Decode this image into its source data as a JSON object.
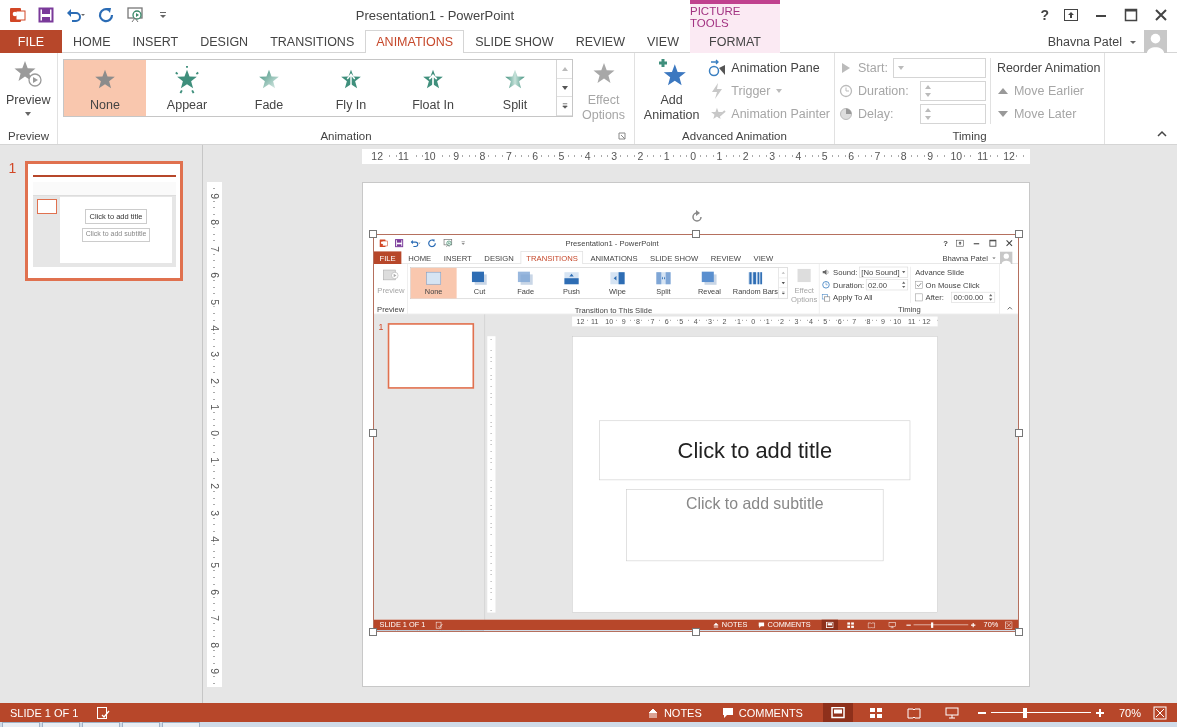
{
  "window": {
    "title": "Presentation1 - PowerPoint",
    "help": "?"
  },
  "contextual_tabs": {
    "group": "PICTURE TOOLS"
  },
  "tabs": [
    {
      "label": "FILE",
      "kind": "file",
      "selected": false
    },
    {
      "label": "HOME",
      "kind": "normal",
      "selected": false
    },
    {
      "label": "INSERT",
      "kind": "normal",
      "selected": false
    },
    {
      "label": "DESIGN",
      "kind": "normal",
      "selected": false
    },
    {
      "label": "TRANSITIONS",
      "kind": "normal",
      "selected": false
    },
    {
      "label": "ANIMATIONS",
      "kind": "normal",
      "selected": true
    },
    {
      "label": "SLIDE SHOW",
      "kind": "normal",
      "selected": false
    },
    {
      "label": "REVIEW",
      "kind": "normal",
      "selected": false
    },
    {
      "label": "VIEW",
      "kind": "normal",
      "selected": false
    },
    {
      "label": "FORMAT",
      "kind": "contextual",
      "selected": false
    }
  ],
  "user": {
    "name": "Bhavna Patel"
  },
  "ribbon": {
    "preview": {
      "label": "Preview",
      "group": "Preview"
    },
    "gallery": [
      {
        "label": "None",
        "kind": "none",
        "selected": true
      },
      {
        "label": "Appear",
        "kind": "appear",
        "selected": false
      },
      {
        "label": "Fade",
        "kind": "fade",
        "selected": false
      },
      {
        "label": "Fly In",
        "kind": "fly",
        "selected": false
      },
      {
        "label": "Float In",
        "kind": "float",
        "selected": false
      },
      {
        "label": "Split",
        "kind": "split",
        "selected": false
      }
    ],
    "effect_options": {
      "label": "Effect Options",
      "disabled": true
    },
    "animation_group": "Animation",
    "add_animation": {
      "label": "Add Animation"
    },
    "advanced": [
      {
        "label": "Animation Pane",
        "kind": "pane",
        "disabled": false
      },
      {
        "label": "Trigger",
        "kind": "trigger",
        "disabled": true
      },
      {
        "label": "Animation Painter",
        "kind": "painter",
        "disabled": true
      }
    ],
    "advanced_group": "Advanced Animation",
    "timing": [
      {
        "label": "Start:",
        "kind": "dropdown",
        "disabled": true
      },
      {
        "label": "Duration:",
        "kind": "spinner",
        "disabled": true
      },
      {
        "label": "Delay:",
        "kind": "spinner",
        "disabled": true
      }
    ],
    "reorder": {
      "title": "Reorder Animation",
      "items": [
        {
          "label": "Move Earlier",
          "kind": "up",
          "disabled": true
        },
        {
          "label": "Move Later",
          "kind": "down",
          "disabled": true
        }
      ]
    },
    "timing_group": "Timing"
  },
  "thumbnails": [
    {
      "number": "1",
      "selected": true,
      "title": "Click to add title",
      "subtitle": "Click to add subtitle"
    }
  ],
  "rulers": {
    "horizontal": [
      "12",
      "11",
      "10",
      "9",
      "8",
      "7",
      "6",
      "5",
      "4",
      "3",
      "2",
      "1",
      "0",
      "1",
      "2",
      "3",
      "4",
      "5",
      "6",
      "7",
      "8",
      "9",
      "10",
      "11",
      "12"
    ],
    "vertical": [
      "9",
      "8",
      "7",
      "6",
      "5",
      "4",
      "3",
      "2",
      "1",
      "0",
      "1",
      "2",
      "3",
      "4",
      "5",
      "6",
      "7",
      "8",
      "9"
    ]
  },
  "slide": {
    "picture_selected": true,
    "screenshot": {
      "title": "Presentation1 - PowerPoint",
      "help": "?",
      "tabs": [
        {
          "label": "FILE",
          "kind": "file",
          "selected": false
        },
        {
          "label": "HOME",
          "kind": "normal",
          "selected": false
        },
        {
          "label": "INSERT",
          "kind": "normal",
          "selected": false
        },
        {
          "label": "DESIGN",
          "kind": "normal",
          "selected": false
        },
        {
          "label": "TRANSITIONS",
          "kind": "normal",
          "selected": true
        },
        {
          "label": "ANIMATIONS",
          "kind": "normal",
          "selected": false
        },
        {
          "label": "SLIDE SHOW",
          "kind": "normal",
          "selected": false
        },
        {
          "label": "REVIEW",
          "kind": "normal",
          "selected": false
        },
        {
          "label": "VIEW",
          "kind": "normal",
          "selected": false
        }
      ],
      "user": "Bhavna Patel",
      "ribbon": {
        "preview": {
          "label": "Preview",
          "group": "Preview"
        },
        "gallery": [
          {
            "label": "None",
            "kind": "none",
            "selected": true
          },
          {
            "label": "Cut",
            "kind": "cut",
            "selected": false
          },
          {
            "label": "Fade",
            "kind": "fade",
            "selected": false
          },
          {
            "label": "Push",
            "kind": "push",
            "selected": false
          },
          {
            "label": "Wipe",
            "kind": "wipe",
            "selected": false
          },
          {
            "label": "Split",
            "kind": "split",
            "selected": false
          },
          {
            "label": "Reveal",
            "kind": "reveal",
            "selected": false
          },
          {
            "label": "Random Bars",
            "kind": "bars",
            "selected": false
          }
        ],
        "effect_options": {
          "label": "Effect Options",
          "disabled": true
        },
        "gallery_group": "Transition to This Slide",
        "sound": {
          "label": "Sound:",
          "value": "[No Sound]"
        },
        "duration": {
          "label": "Duration:",
          "value": "02.00"
        },
        "apply_all": "Apply To All",
        "advance": {
          "title": "Advance Slide",
          "options": [
            {
              "label": "On Mouse Click",
              "checked": true
            },
            {
              "label": "After:",
              "checked": false,
              "value": "00:00.00"
            }
          ]
        },
        "timing_group": "Timing"
      },
      "thumbnails": [
        {
          "number": "1",
          "selected": true
        }
      ],
      "ruler": [
        "12",
        "11",
        "10",
        "9",
        "8",
        "7",
        "6",
        "5",
        "4",
        "3",
        "2",
        "1",
        "0",
        "1",
        "2",
        "3",
        "4",
        "5",
        "6",
        "7",
        "8",
        "9",
        "10",
        "11",
        "12"
      ],
      "slide": {
        "title": "Click to add title",
        "subtitle": "Click to add subtitle"
      },
      "status_bar": {
        "slide": "SLIDE 1 OF 1",
        "notes": "NOTES",
        "comments": "COMMENTS",
        "views": [
          {
            "kind": "normal",
            "selected": true
          },
          {
            "kind": "sorter",
            "selected": false
          },
          {
            "kind": "reading",
            "selected": false
          },
          {
            "kind": "show",
            "selected": false
          }
        ],
        "zoom": {
          "level": 0.34
        },
        "zoom_text": "70%"
      }
    }
  },
  "status_bar": {
    "slide": "SLIDE 1 OF 1",
    "notes": "NOTES",
    "comments": "COMMENTS",
    "views": [
      {
        "kind": "normal",
        "selected": true
      },
      {
        "kind": "sorter",
        "selected": false
      },
      {
        "kind": "reading",
        "selected": false
      },
      {
        "kind": "show",
        "selected": false
      }
    ],
    "zoom": {
      "level": 0.34
    },
    "zoom_text": "70%"
  }
}
